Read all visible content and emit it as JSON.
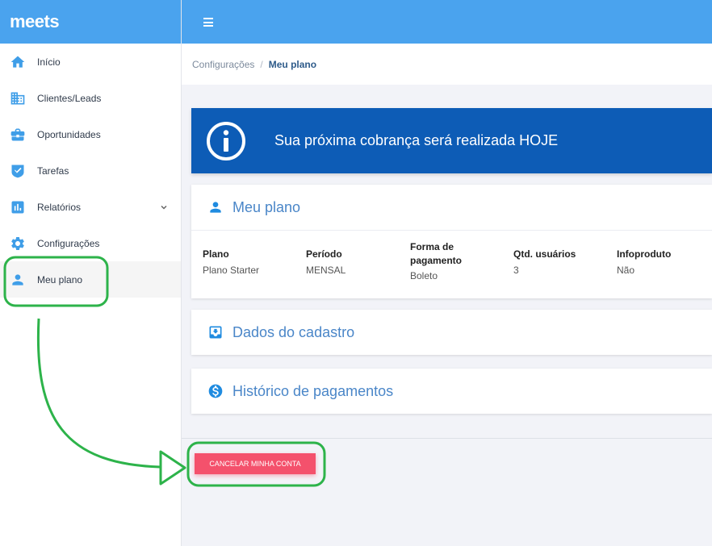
{
  "brand": {
    "name": "meets"
  },
  "sidebar": {
    "items": [
      {
        "label": "Início",
        "icon": "home-icon"
      },
      {
        "label": "Clientes/Leads",
        "icon": "building-icon"
      },
      {
        "label": "Oportunidades",
        "icon": "briefcase-icon"
      },
      {
        "label": "Tarefas",
        "icon": "check-shield-icon"
      },
      {
        "label": "Relatórios",
        "icon": "bar-chart-icon"
      },
      {
        "label": "Configurações",
        "icon": "gear-icon"
      },
      {
        "label": "Meu plano",
        "icon": "user-icon"
      }
    ]
  },
  "breadcrumb": {
    "parent": "Configurações",
    "separator": "/",
    "current": "Meu plano"
  },
  "banner": {
    "text": "Sua próxima cobrança será realizada HOJE",
    "color": "#0d5cb6"
  },
  "plan_card": {
    "title": "Meu plano",
    "columns": [
      {
        "header": "Plano",
        "value": "Plano Starter"
      },
      {
        "header": "Período",
        "value": "MENSAL"
      },
      {
        "header": "Forma de pagamento",
        "value": "Boleto"
      },
      {
        "header": "Qtd. usuários",
        "value": "3"
      },
      {
        "header": "Infoproduto",
        "value": "Não"
      }
    ]
  },
  "registration_card": {
    "title": "Dados do cadastro"
  },
  "payments_card": {
    "title": "Histórico de pagamentos"
  },
  "cancel_button": {
    "label": "CANCELAR MINHA CONTA",
    "color": "#f4516c"
  },
  "colors": {
    "accent": "#4aa3ee",
    "annotation": "#2db34a"
  }
}
